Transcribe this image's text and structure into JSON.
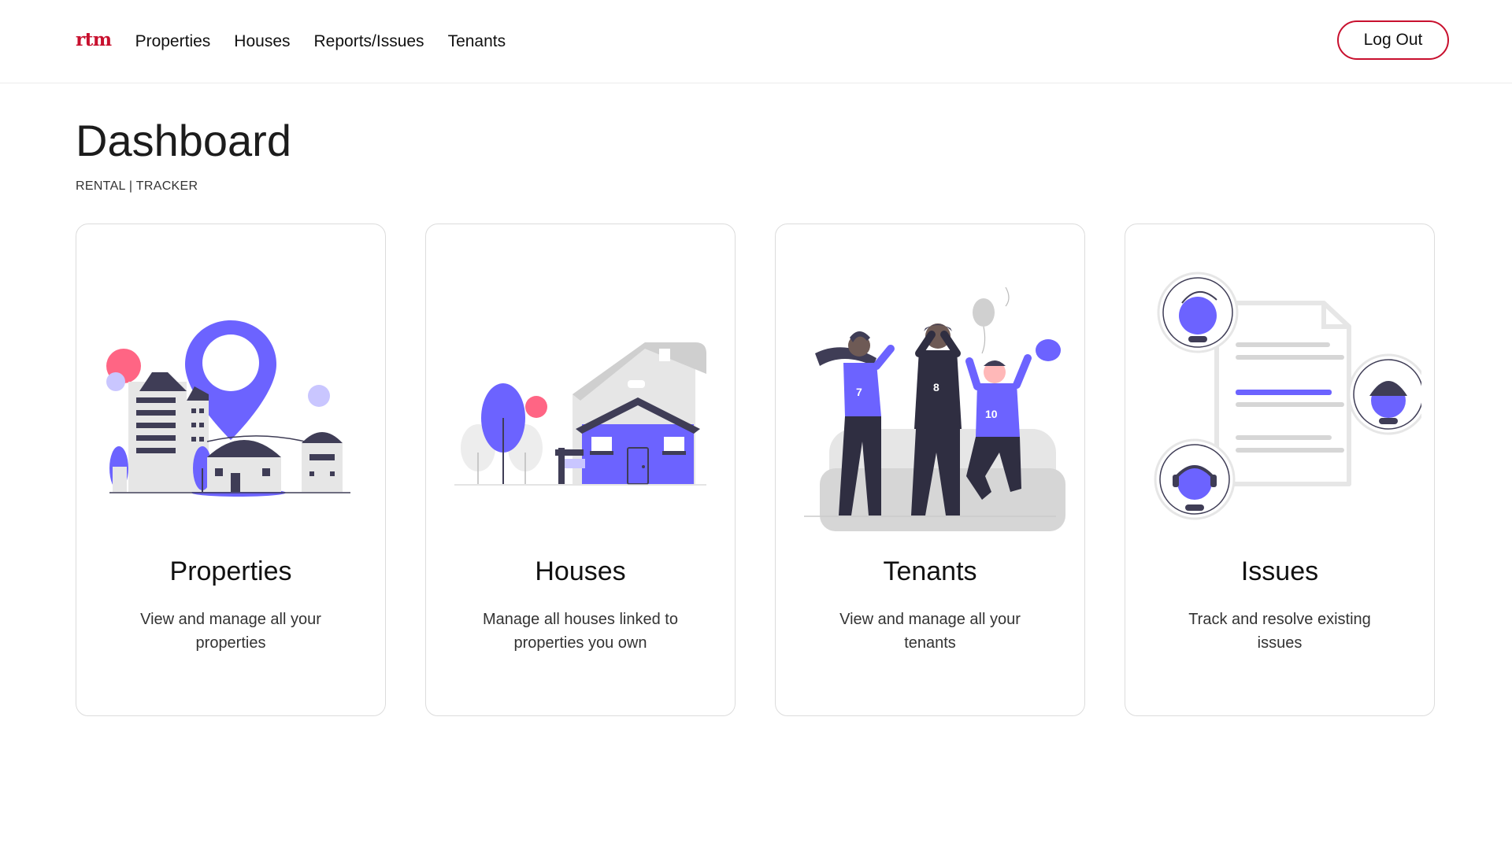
{
  "brand": {
    "logo_text": "rtm",
    "accent": "#c8102e"
  },
  "nav": {
    "items": [
      {
        "label": "Properties"
      },
      {
        "label": "Houses"
      },
      {
        "label": "Reports/Issues"
      },
      {
        "label": "Tenants"
      }
    ],
    "logout_label": "Log Out"
  },
  "header": {
    "title": "Dashboard",
    "subtitle": "RENTAL | TRACKER"
  },
  "cards": [
    {
      "title": "Properties",
      "description": "View and manage all your properties",
      "icon": "city-location-illustration"
    },
    {
      "title": "Houses",
      "description": "Manage all houses linked to properties you own",
      "icon": "house-illustration"
    },
    {
      "title": "Tenants",
      "description": "View and manage all your tenants",
      "icon": "people-celebrating-illustration"
    },
    {
      "title": "Issues",
      "description": "Track and resolve existing issues",
      "icon": "document-support-illustration"
    }
  ],
  "illustration_colors": {
    "purple": "#6c63ff",
    "dark": "#3f3d56",
    "pink": "#ff6584",
    "gray": "#d6d6d6"
  }
}
